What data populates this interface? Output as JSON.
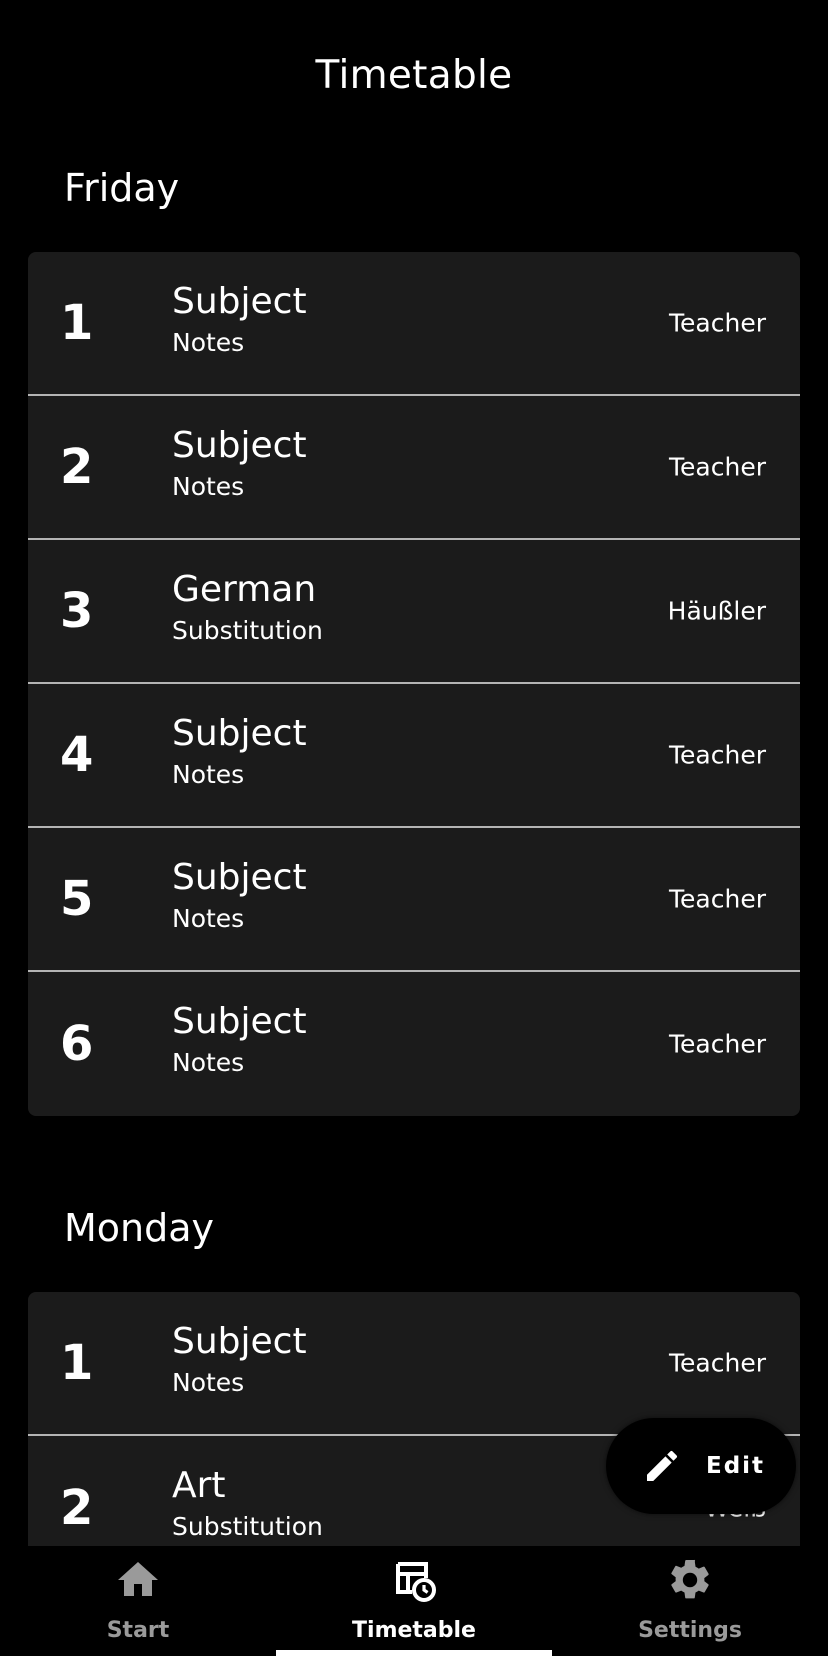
{
  "header": {
    "title": "Timetable"
  },
  "days": [
    {
      "name": "Friday",
      "lessons": [
        {
          "number": "1",
          "subject": "Subject",
          "note": "Notes",
          "teacher": "Teacher"
        },
        {
          "number": "2",
          "subject": "Subject",
          "note": "Notes",
          "teacher": "Teacher"
        },
        {
          "number": "3",
          "subject": "German",
          "note": "Substitution",
          "teacher": "Häußler"
        },
        {
          "number": "4",
          "subject": "Subject",
          "note": "Notes",
          "teacher": "Teacher"
        },
        {
          "number": "5",
          "subject": "Subject",
          "note": "Notes",
          "teacher": "Teacher"
        },
        {
          "number": "6",
          "subject": "Subject",
          "note": "Notes",
          "teacher": "Teacher"
        }
      ]
    },
    {
      "name": "Monday",
      "lessons": [
        {
          "number": "1",
          "subject": "Subject",
          "note": "Notes",
          "teacher": "Teacher"
        },
        {
          "number": "2",
          "subject": "Art",
          "note": "Substitution",
          "teacher": "Weiß"
        }
      ]
    }
  ],
  "fab": {
    "label": "Edit",
    "icon": "pencil-icon"
  },
  "nav": {
    "items": [
      {
        "label": "Start",
        "icon": "home-icon"
      },
      {
        "label": "Timetable",
        "icon": "timetable-clock-icon"
      },
      {
        "label": "Settings",
        "icon": "gear-icon"
      }
    ],
    "active": "Timetable"
  },
  "colors": {
    "background": "#000000",
    "card": "#1b1b1b",
    "divider": "#b4b4b4",
    "text": "#ffffff",
    "nav_inactive": "#9a9a9a"
  }
}
